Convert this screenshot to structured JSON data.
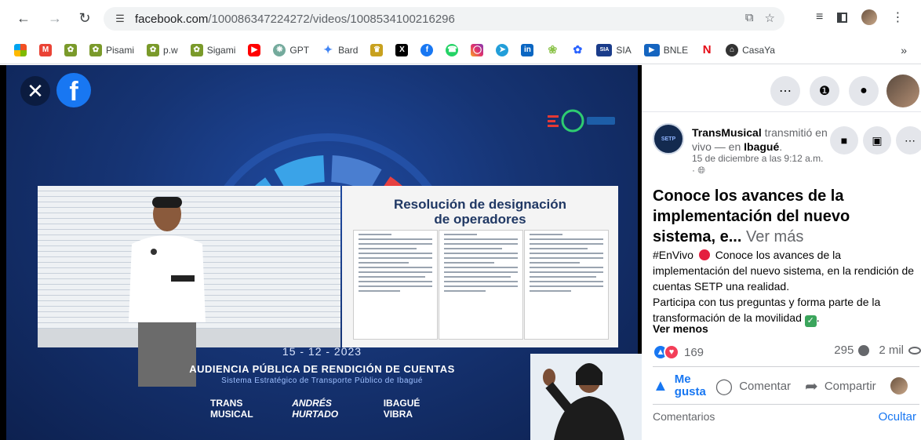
{
  "browser": {
    "url_host": "facebook.com",
    "url_path": "/100086347224272/videos/1008534100216296",
    "bookmarks": [
      {
        "label": "",
        "icon": "windows-icon",
        "color": "#f25022"
      },
      {
        "label": "",
        "icon": "gmail-icon",
        "color": "#ea4335"
      },
      {
        "label": "",
        "icon": "bee-icon",
        "color": "#7a9a2a"
      },
      {
        "label": "Pisami",
        "icon": "bee-icon",
        "color": "#7a9a2a"
      },
      {
        "label": "p.w",
        "icon": "bee-icon",
        "color": "#7a9a2a"
      },
      {
        "label": "Sigami",
        "icon": "bee-icon",
        "color": "#7a9a2a"
      },
      {
        "label": "",
        "icon": "youtube-icon",
        "color": "#ff0000"
      },
      {
        "label": "GPT",
        "icon": "chatgpt-icon",
        "color": "#74aa9c"
      },
      {
        "label": "Bard",
        "icon": "bard-icon",
        "color": "#4285f4"
      },
      {
        "label": "",
        "icon": "seal-icon",
        "color": "#c8a11e"
      },
      {
        "label": "",
        "icon": "x-icon",
        "color": "#000000"
      },
      {
        "label": "",
        "icon": "facebook-icon",
        "color": "#1877f2"
      },
      {
        "label": "",
        "icon": "whatsapp-icon",
        "color": "#25d366"
      },
      {
        "label": "",
        "icon": "instagram-icon",
        "color": "#e1306c"
      },
      {
        "label": "",
        "icon": "telegram-icon",
        "color": "#229ed9"
      },
      {
        "label": "",
        "icon": "linkedin-icon",
        "color": "#0a66c2"
      },
      {
        "label": "",
        "icon": "leaf-icon",
        "color": "#8bc34a"
      },
      {
        "label": "",
        "icon": "feather-icon",
        "color": "#2962ff"
      },
      {
        "label": "SIA",
        "icon": "sia-icon",
        "color": "#1a3c8a"
      },
      {
        "label": "BNLE",
        "icon": "bnle-icon",
        "color": "#1565c0"
      },
      {
        "label": "",
        "icon": "netflix-icon",
        "color": "#e50914"
      },
      {
        "label": "CasaYa",
        "icon": "casaya-icon",
        "color": "#333333"
      }
    ],
    "more_label": "»"
  },
  "video": {
    "slide_title_line1": "Resolución de designación",
    "slide_title_line2": "de operadores",
    "event_date": "15 - 12 - 2023",
    "event_title": "AUDIENCIA PÚBLICA DE RENDICIÓN DE CUENTAS",
    "event_subtitle": "Sistema Estratégico de Transporte Público de Ibagué",
    "logo_transmusical": "TRANS MUSICAL",
    "logo_hurtado": "ANDRÉS HURTADO",
    "logo_ibague": "IBAGUÉ VIBRA"
  },
  "post": {
    "page_name": "TransMusical",
    "action_text": "transmitió en vivo — en",
    "place": "Ibagué",
    "date": "15 de diciembre a las 9:12 a.m.",
    "date_suffix": "·",
    "title": "Conoce los avances de la implementación del nuevo sistema, e...",
    "see_more": "Ver más",
    "hashtag": "#EnVivo",
    "body_1": "Conoce los avances de la implementación del nuevo sistema, en la rendición de cuentas SETP una realidad.",
    "body_2": "Participa con tus preguntas y forma parte de la transformación de la movilidad",
    "body_2_end": ".",
    "see_less": "Ver menos",
    "reaction_count": "169",
    "comment_count": "295",
    "view_count": "2 mil",
    "like_label": "Me gusta",
    "comment_label": "Comentar",
    "share_label": "Compartir",
    "comments_label": "Comentarios",
    "hide_label": "Ocultar"
  },
  "colors": {
    "fb_blue": "#1877f2",
    "live_red": "#e41e3f",
    "love_red": "#f33e58"
  }
}
